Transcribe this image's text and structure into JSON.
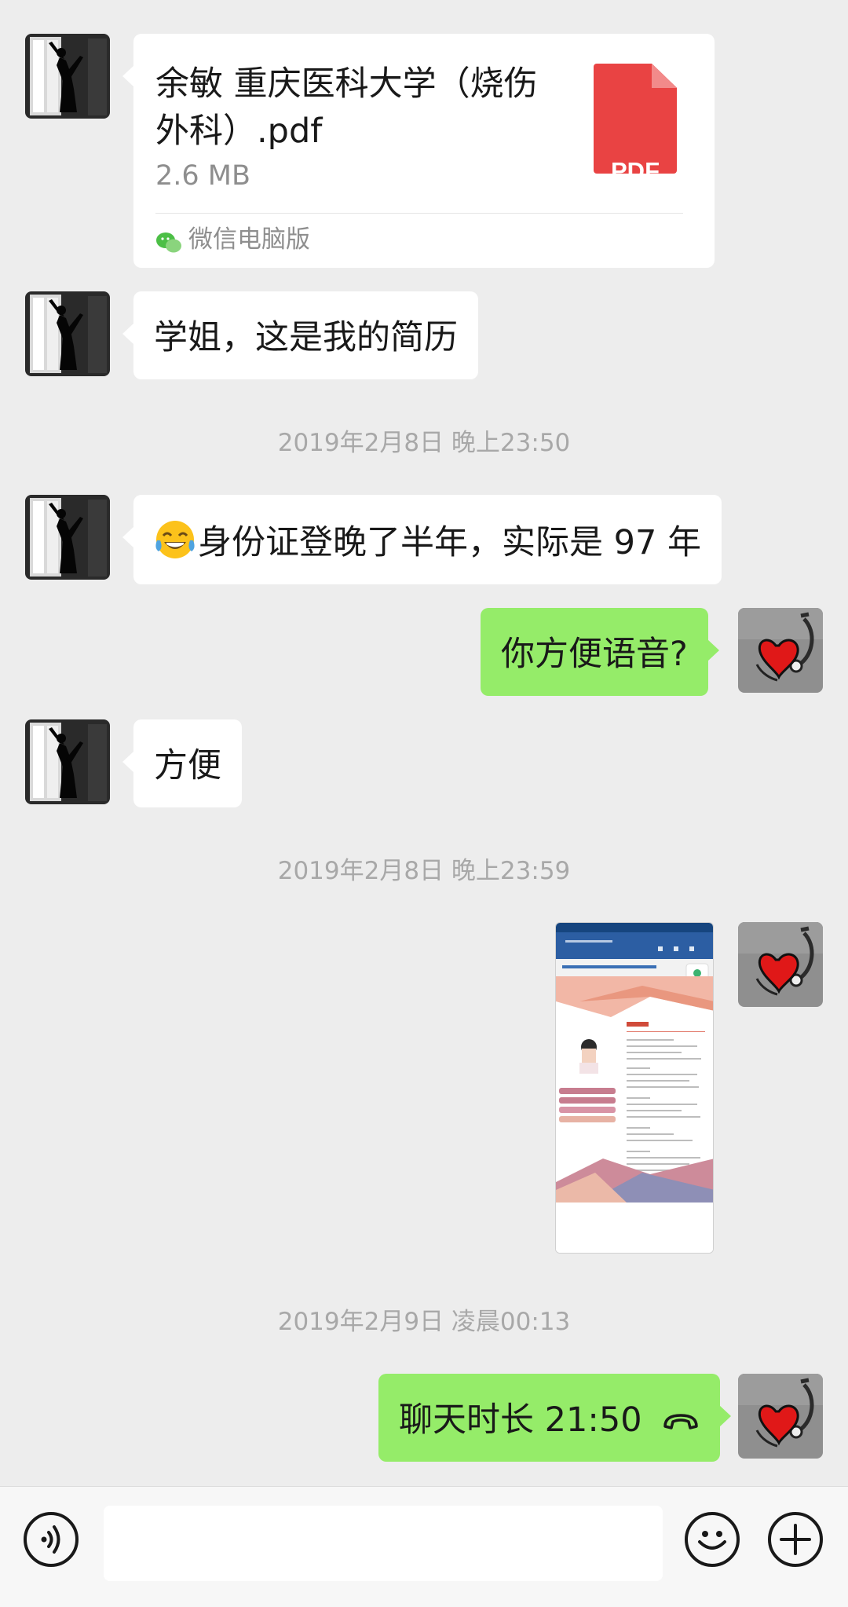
{
  "messages": {
    "file": {
      "name": "余敏 重庆医科大学（烧伤外科）.pdf",
      "size": "2.6 MB",
      "type_label": "PDF",
      "source": "微信电脑版"
    },
    "msg1": "学姐，这是我的简历",
    "ts1": "2019年2月8日 晚上23:50",
    "msg2": "身份证登晚了半年，实际是 97 年",
    "msg3": "你方便语音?",
    "msg4": "方便",
    "ts2": "2019年2月8日 晚上23:59",
    "ts3": "2019年2月9日 凌晨00:13",
    "msg5": "聊天时长 21:50"
  },
  "colors": {
    "background": "#ededed",
    "sent_bubble": "#95ec69",
    "received_bubble": "#ffffff",
    "pdf_red": "#e94343"
  },
  "icons": {
    "emoji": "tears-of-joy-emoji",
    "call_end": "phone-hangup-icon",
    "voice": "voice-input-icon",
    "emoji_button": "smiley-icon",
    "more": "plus-icon",
    "source_app": "wechat-icon"
  }
}
